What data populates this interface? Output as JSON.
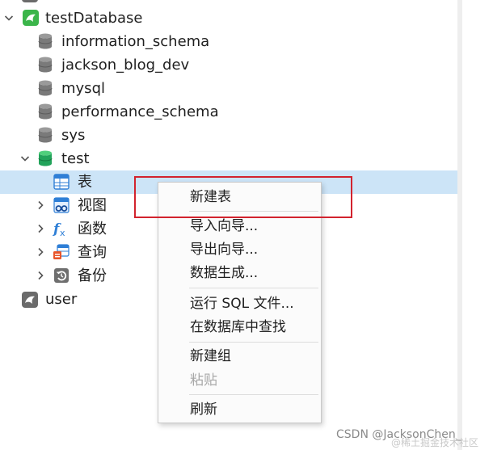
{
  "tree": {
    "connection": {
      "label": "testDatabase"
    },
    "databases": [
      {
        "label": "information_schema"
      },
      {
        "label": "jackson_blog_dev"
      },
      {
        "label": "mysql"
      },
      {
        "label": "performance_schema"
      },
      {
        "label": "sys"
      },
      {
        "label": "test"
      }
    ],
    "test_children": [
      {
        "label": "表"
      },
      {
        "label": "视图"
      },
      {
        "label": "函数"
      },
      {
        "label": "查询"
      },
      {
        "label": "备份"
      }
    ],
    "other_connection": {
      "label": "user"
    }
  },
  "context_menu": {
    "items": {
      "new_table": "新建表",
      "import_wizard": "导入向导...",
      "export_wizard": "导出向导...",
      "data_generation": "数据生成...",
      "run_sql_file": "运行 SQL 文件...",
      "find_in_database": "在数据库中查找",
      "new_group": "新建组",
      "paste": "粘贴",
      "refresh": "刷新"
    }
  },
  "watermark": {
    "text": "CSDN @JacksonChen_",
    "faint": "@稀土掘金技术社区"
  },
  "colors": {
    "selection": "#cce4f7",
    "annotation_red": "#d2232e",
    "connection_green": "#3bb54a",
    "db_active_green": "#22a35a",
    "db_gray": "#8a8a8a"
  },
  "icons": {
    "connection": "dolphin-connection-icon",
    "database": "database-cylinder-icon",
    "table": "table-grid-icon",
    "view": "view-glasses-icon",
    "function": "fx-function-icon",
    "query": "query-icon",
    "backup": "backup-restore-icon"
  }
}
